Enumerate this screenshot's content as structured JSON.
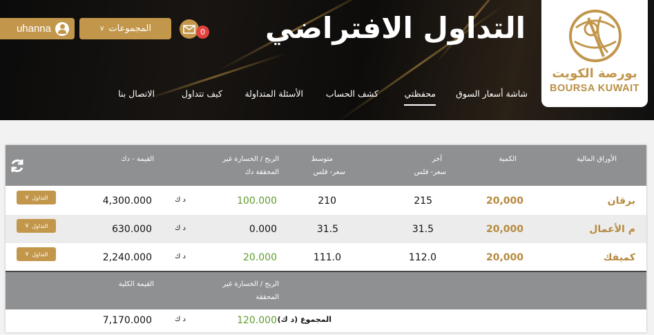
{
  "header": {
    "title": "التداول الافتراضي",
    "logo_ar": "بورصة الكويت",
    "logo_en": "BOURSA KUWAIT",
    "user_label": "uhanna",
    "groups_label": "المجموعات",
    "mail_count": "0",
    "nav": [
      "شاشة أسعار السوق",
      "محفظتي",
      "كشف الحساب",
      "الأسئلة المتداولة",
      "كيف تتداول",
      "الاتصال بنا"
    ],
    "active_nav": "محفظتي"
  },
  "table": {
    "headers": {
      "security": "الأوراق المالية",
      "quantity": "الكمية",
      "last_price_1": "آخر",
      "last_price_2": "سعر- فلس",
      "avg_price_1": "متوسط",
      "avg_price_2": "سعر- فلس",
      "pl_1": "الربح / الخسارة غير",
      "pl_2": "المحققة دك",
      "value": "القيمة - دك"
    },
    "rows": [
      {
        "name": "برقان",
        "quantity": "20,000",
        "last": "215",
        "avg": "210",
        "pl": "100.000",
        "currency": "د ك",
        "value": "4,300.000",
        "action": "التداول"
      },
      {
        "name": "م الأعمال",
        "quantity": "20,000",
        "last": "31.5",
        "avg": "31.5",
        "pl": "0.000",
        "currency": "د ك",
        "value": "630.000",
        "action": "التداول"
      },
      {
        "name": "كميفك",
        "quantity": "20,000",
        "last": "112.0",
        "avg": "111.0",
        "pl": "20.000",
        "currency": "د ك",
        "value": "2,240.000",
        "action": "التداول"
      }
    ],
    "footer_headers": {
      "pl_1": "الربح / الخسارة غير",
      "pl_2": "المحققة",
      "total_value": "القيمة الكلية"
    },
    "totals": {
      "label": "المجموع (د ك)",
      "pl": "120.000",
      "currency": "د ك",
      "value": "7,170.000"
    }
  },
  "colors": {
    "gold": "#c3974b",
    "header_gray": "#8f9092",
    "positive_green": "#5e9c2c",
    "badge_red": "#e0443e"
  }
}
